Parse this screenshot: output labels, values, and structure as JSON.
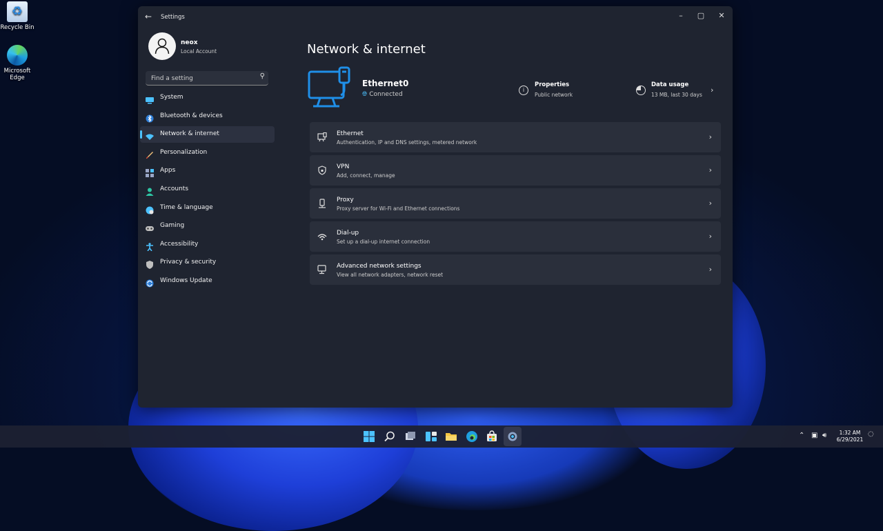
{
  "desktop": {
    "icons": [
      {
        "label": "Recycle Bin"
      },
      {
        "label": "Microsoft Edge"
      }
    ]
  },
  "window": {
    "title": "Settings",
    "controls": {
      "minimize": "–",
      "maximize": "▢",
      "close": "✕"
    }
  },
  "user": {
    "name": "neox",
    "account_type": "Local Account"
  },
  "search": {
    "placeholder": "Find a setting"
  },
  "nav": {
    "items": [
      {
        "label": "System",
        "icon": "monitor-icon",
        "color": "#4cc2ff"
      },
      {
        "label": "Bluetooth & devices",
        "icon": "bluetooth-icon",
        "color": "#4cc2ff"
      },
      {
        "label": "Network & internet",
        "icon": "wifi-icon",
        "color": "#4cc2ff",
        "active": true
      },
      {
        "label": "Personalization",
        "icon": "brush-icon",
        "color": "#f7a35c"
      },
      {
        "label": "Apps",
        "icon": "apps-icon",
        "color": "#a0a8c0"
      },
      {
        "label": "Accounts",
        "icon": "person-icon",
        "color": "#2ec6a4"
      },
      {
        "label": "Time & language",
        "icon": "globe-clock-icon",
        "color": "#4cc2ff"
      },
      {
        "label": "Gaming",
        "icon": "gamepad-icon",
        "color": "#bfbfbf"
      },
      {
        "label": "Accessibility",
        "icon": "accessibility-icon",
        "color": "#4cc2ff"
      },
      {
        "label": "Privacy & security",
        "icon": "shield-icon",
        "color": "#bfbfbf"
      },
      {
        "label": "Windows Update",
        "icon": "update-icon",
        "color": "#4cc2ff"
      }
    ]
  },
  "main": {
    "title": "Network & internet",
    "connection": {
      "name": "Ethernet0",
      "status": "Connected"
    },
    "properties": {
      "title": "Properties",
      "subtitle": "Public network"
    },
    "data_usage": {
      "title": "Data usage",
      "subtitle": "13 MB, last 30 days"
    },
    "cards": [
      {
        "title": "Ethernet",
        "subtitle": "Authentication, IP and DNS settings, metered network",
        "icon": "ethernet-icon"
      },
      {
        "title": "VPN",
        "subtitle": "Add, connect, manage",
        "icon": "vpn-shield-icon"
      },
      {
        "title": "Proxy",
        "subtitle": "Proxy server for Wi-Fi and Ethernet connections",
        "icon": "proxy-icon"
      },
      {
        "title": "Dial-up",
        "subtitle": "Set up a dial-up internet connection",
        "icon": "dialup-icon"
      },
      {
        "title": "Advanced network settings",
        "subtitle": "View all network adapters, network reset",
        "icon": "advanced-network-icon"
      }
    ]
  },
  "taskbar": {
    "time": "1:32 AM",
    "date": "6/29/2021",
    "accent": "#4cc2ff"
  }
}
